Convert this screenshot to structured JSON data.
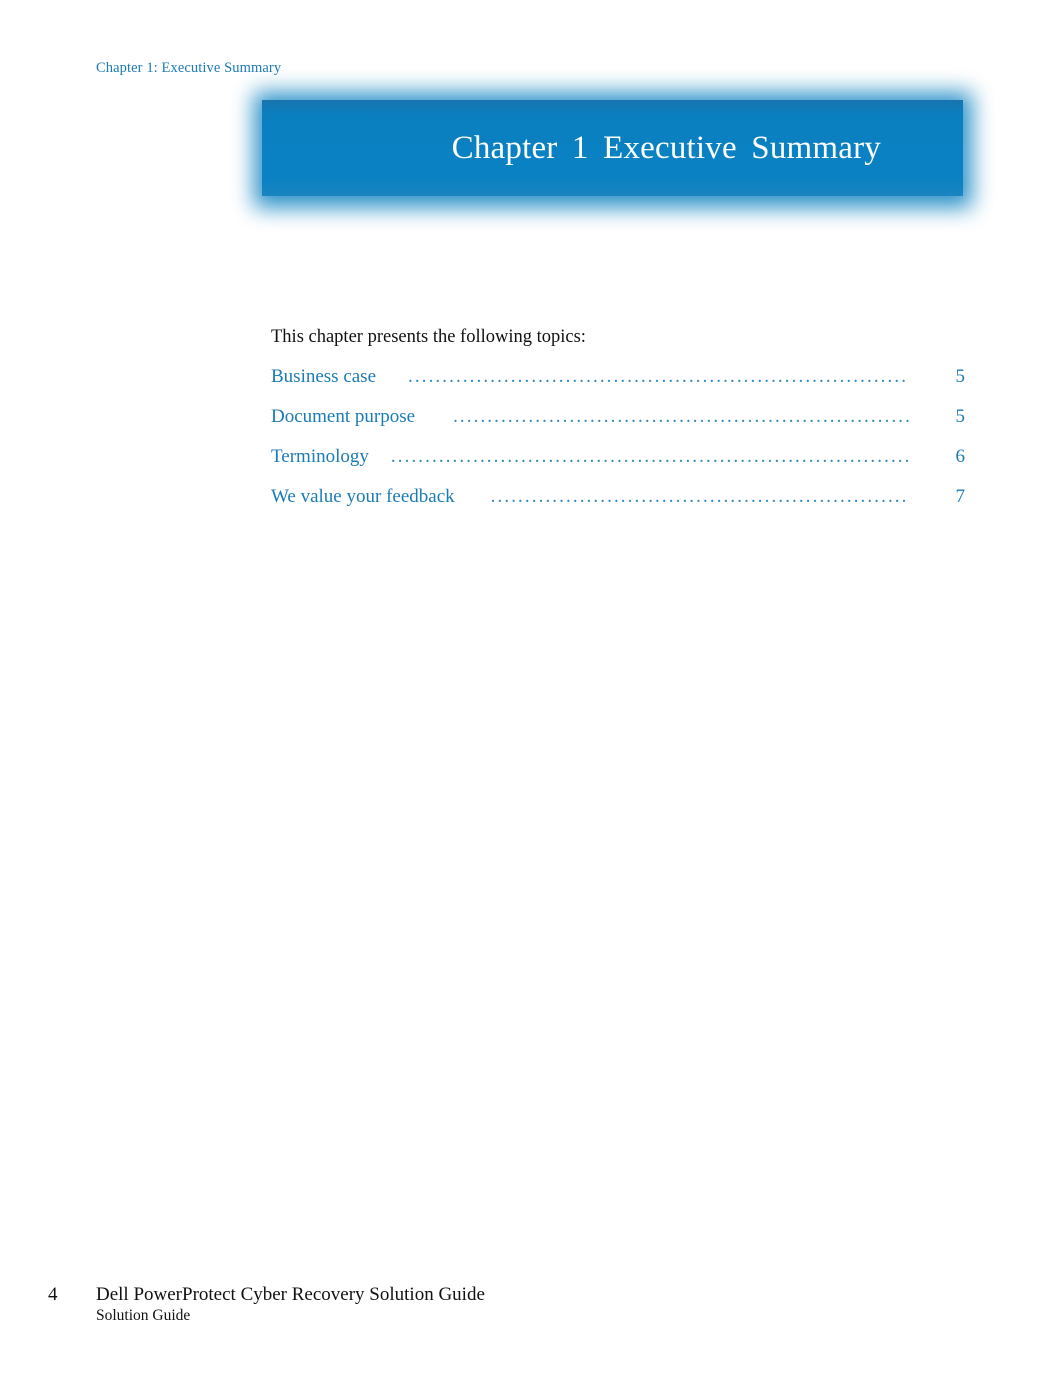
{
  "header": {
    "running_head": "Chapter 1: Executive Summary"
  },
  "banner": {
    "title": "Chapter  1  Executive  Summary",
    "background_color": "#0a81c2",
    "text_color": "#ffffff"
  },
  "body": {
    "intro": "This chapter presents the following topics:"
  },
  "toc": {
    "leader_dots_1": "..............................................................................................",
    "leader_dots_2": "..............................................................................................",
    "leader_dots_3": "..............................................................................................",
    "leader_dots_4": "..............................................................................................",
    "entries": [
      {
        "label": "Business case",
        "page": "5"
      },
      {
        "label": "Document purpose",
        "page": "5"
      },
      {
        "label": "Terminology",
        "page": "6"
      },
      {
        "label": "We value your feedback",
        "page": "7"
      }
    ]
  },
  "footer": {
    "page_number": "4",
    "document_title": "Dell PowerProtect Cyber Recovery Solution Guide",
    "document_subtitle": "Solution Guide"
  },
  "colors": {
    "link_blue": "#1b7bb5",
    "banner_blue": "#0a81c2",
    "text_black": "#111111"
  }
}
